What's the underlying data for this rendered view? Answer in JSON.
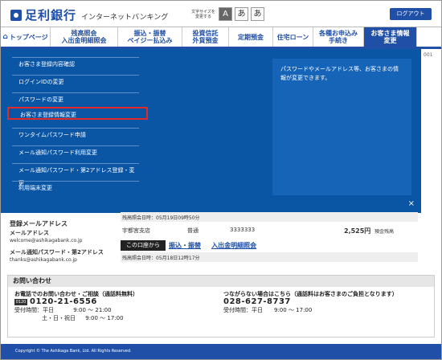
{
  "header": {
    "bank_name": "足利銀行",
    "service_name": "インターネットバンキング",
    "font_size_label": "文字サイズを変更する",
    "font_size_options": [
      "A",
      "あ",
      "あ"
    ],
    "logout_label": "ログアウト"
  },
  "nav": {
    "items": [
      "トップページ",
      "残高照会\n入出金明細照会",
      "振込・振替\nペイジー払込み",
      "投資信託\n外貨預金",
      "定期預金",
      "住宅ローン",
      "各種お申込み\n手続き",
      "お客さま情報\n変更"
    ]
  },
  "dropdown": {
    "items": [
      "お客さま登録内容確認",
      "ログインIDの変更",
      "パスワードの変更",
      "お客さま登録情報変更",
      "ワンタイムパスワード申請",
      "メール通知パスワード利用変更",
      "メール通知パスワード・第2アドレス登録・変更",
      "利用端末変更"
    ],
    "selected_index": 3,
    "description": "パスワードやメールアドレス等、お客さまの情報が変更できます。",
    "close_label": "×"
  },
  "content": {
    "side_mark": "001",
    "email_heading": "登録メールアドレス",
    "email_label": "メールアドレス",
    "email_value": "welcome@ashikagabank.co.jp",
    "second_email_label": "メール通知パスワード・第2アドレス",
    "second_email_value": "thanks@ashikagabank.co.jp",
    "balance_date_1": "残高照会日時：05月19日09時50分",
    "branch": "宇都宮支店",
    "account_type": "普通",
    "account_number": "3333333",
    "balance": "2,525円",
    "balance_label": "預金残高",
    "tag_label": "この口座から",
    "link_transfer": "振込・振替",
    "link_statement": "入出金明細照会",
    "balance_date_2": "残高照会日時：05月18日12時17分"
  },
  "inquiry": {
    "title": "お問い合わせ",
    "left_heading": "お電話でのお問い合わせ・ご相談（通話料無料）",
    "freedial_label": "0120",
    "phone_1": "0120-21-6556",
    "hours_label": "受付時間：平日",
    "hours_weekday": "9:00 ～ 21:00",
    "hours_weekend_label": "土・日・祝日",
    "hours_weekend": "9:00 ～ 17:00",
    "right_heading": "つながらない場合はこちら（通話料はお客さまのご負担となります）",
    "phone_2": "028-627-8737",
    "hours_right": "受付時間：平日　　9:00 ～ 17:00"
  },
  "footer": {
    "copyright": "Copyright © The Ashikaga Bank, Ltd. All Rights Reserved."
  }
}
